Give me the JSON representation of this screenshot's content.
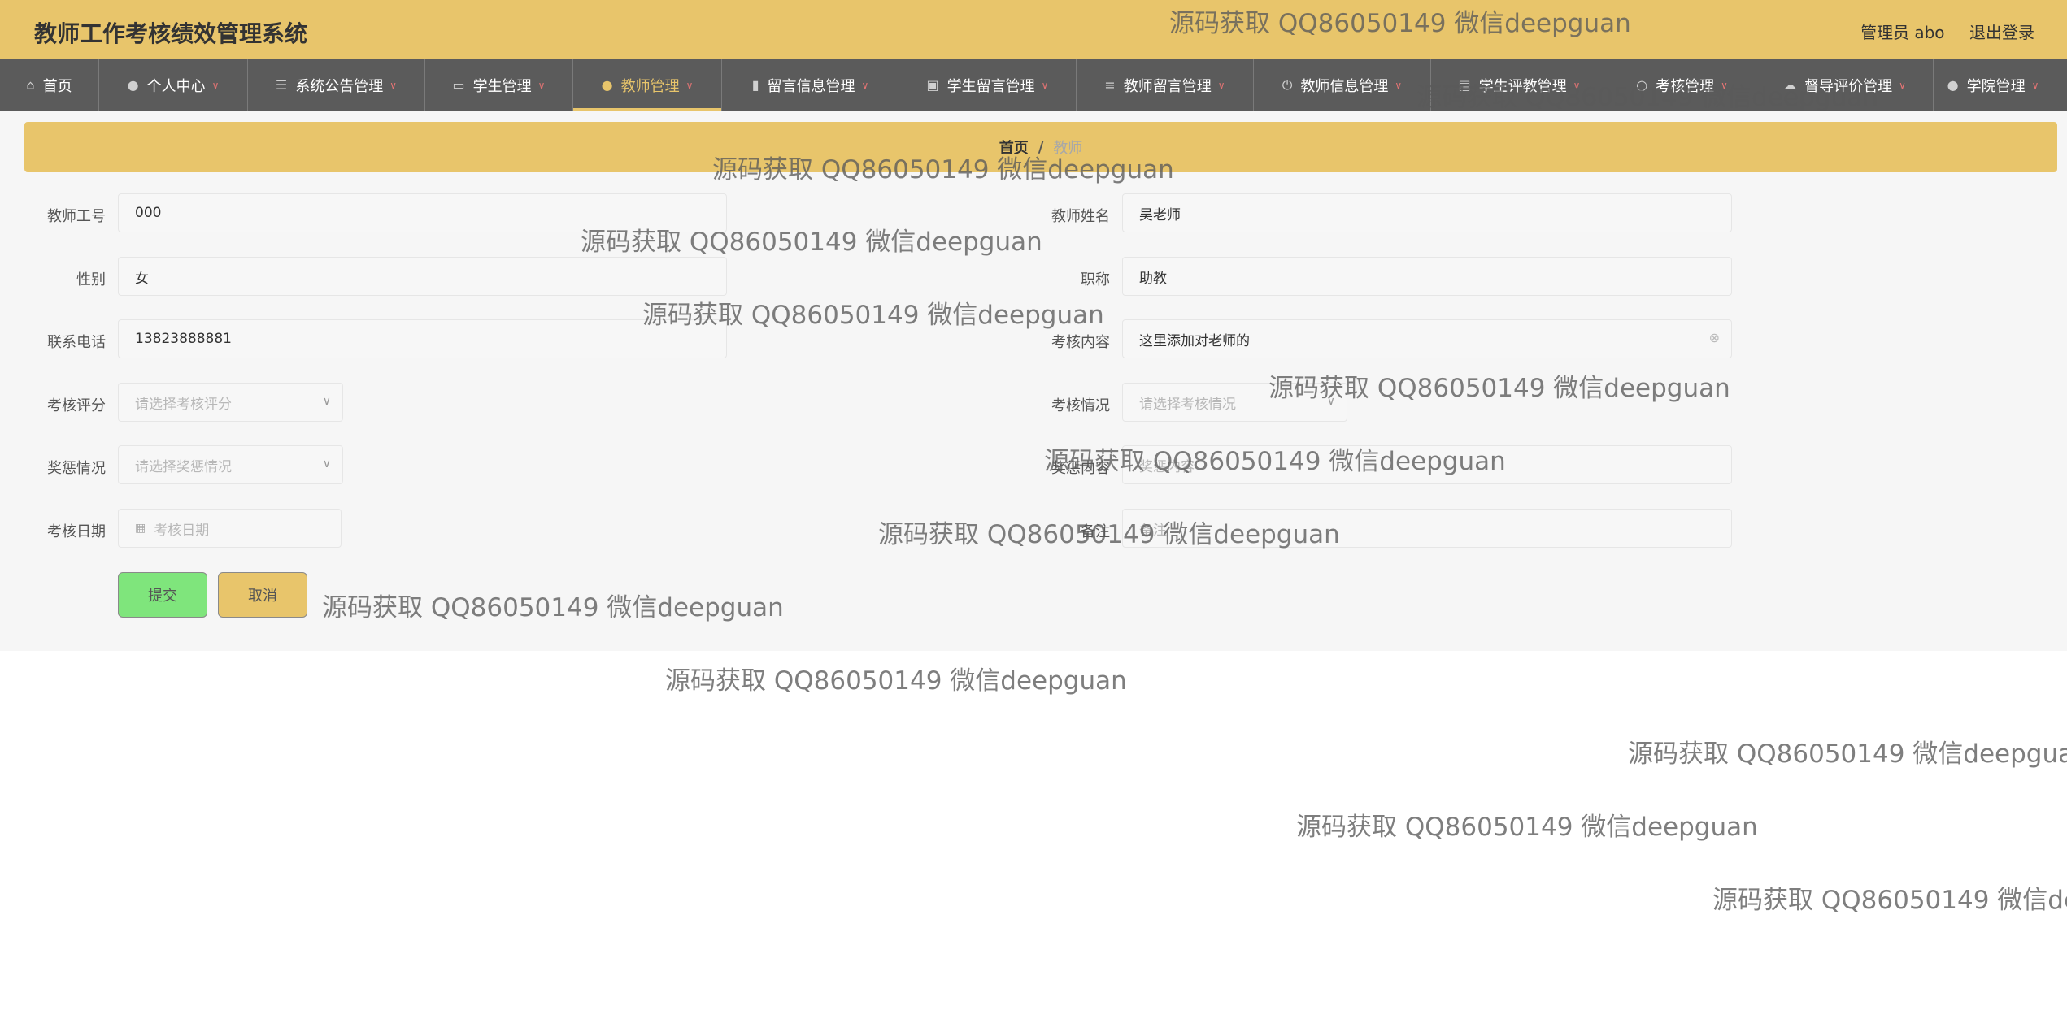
{
  "header": {
    "title": "教师工作考核绩效管理系统",
    "user": "管理员 abo",
    "logout": "退出登录",
    "bg_color": "#e8c56b"
  },
  "nav": {
    "items": [
      {
        "label": "首页",
        "icon": "home-icon",
        "glyph": "⌂",
        "has_menu": false,
        "active": false
      },
      {
        "label": "个人中心",
        "icon": "user-icon",
        "glyph": "●",
        "has_menu": true,
        "active": false
      },
      {
        "label": "系统公告管理",
        "icon": "sliders-icon",
        "glyph": "☰",
        "has_menu": true,
        "active": false
      },
      {
        "label": "学生管理",
        "icon": "chat-icon",
        "glyph": "▭",
        "has_menu": true,
        "active": false
      },
      {
        "label": "教师管理",
        "icon": "location-icon",
        "glyph": "●",
        "has_menu": true,
        "active": true
      },
      {
        "label": "留言信息管理",
        "icon": "bar-chart-icon",
        "glyph": "▮",
        "has_menu": true,
        "active": false
      },
      {
        "label": "学生留言管理",
        "icon": "clipboard-icon",
        "glyph": "▣",
        "has_menu": true,
        "active": false
      },
      {
        "label": "教师留言管理",
        "icon": "list-icon",
        "glyph": "≡",
        "has_menu": true,
        "active": false
      },
      {
        "label": "教师信息管理",
        "icon": "power-icon",
        "glyph": "⏻",
        "has_menu": true,
        "active": false
      },
      {
        "label": "学生评教管理",
        "icon": "doc-icon",
        "glyph": "▤",
        "has_menu": true,
        "active": false
      },
      {
        "label": "考核管理",
        "icon": "circle-icon",
        "glyph": "○",
        "has_menu": true,
        "active": false
      },
      {
        "label": "督导评价管理",
        "icon": "cloud-icon",
        "glyph": "☁",
        "has_menu": true,
        "active": false
      },
      {
        "label": "学院管理",
        "icon": "user-icon",
        "glyph": "●",
        "has_menu": true,
        "active": false
      }
    ],
    "active_color": "#e8c56b"
  },
  "breadcrumb": {
    "home": "首页",
    "sep": "/",
    "current": "教师"
  },
  "form": {
    "teacher_no": {
      "label": "教师工号",
      "value": "000"
    },
    "teacher_name": {
      "label": "教师姓名",
      "value": "吴老师"
    },
    "gender": {
      "label": "性别",
      "value": "女"
    },
    "title": {
      "label": "职称",
      "value": "助教"
    },
    "phone": {
      "label": "联系电话",
      "value": "13823888881"
    },
    "content": {
      "label": "考核内容",
      "value": "这里添加对老师的"
    },
    "score": {
      "label": "考核评分",
      "placeholder": "请选择考核评分"
    },
    "status": {
      "label": "考核情况",
      "placeholder": "请选择考核情况"
    },
    "reward": {
      "label": "奖惩情况",
      "placeholder": "请选择奖惩情况"
    },
    "reward_content": {
      "label": "奖惩内容",
      "placeholder": "奖惩内容"
    },
    "date": {
      "label": "考核日期",
      "placeholder": "考核日期"
    },
    "remark": {
      "label": "备注",
      "placeholder": "备注"
    }
  },
  "buttons": {
    "submit": "提交",
    "cancel": "取消",
    "submit_color": "#7fe57c",
    "cancel_color": "#e8c56b"
  },
  "watermark": "源码获取 QQ86050149 微信deepguan"
}
